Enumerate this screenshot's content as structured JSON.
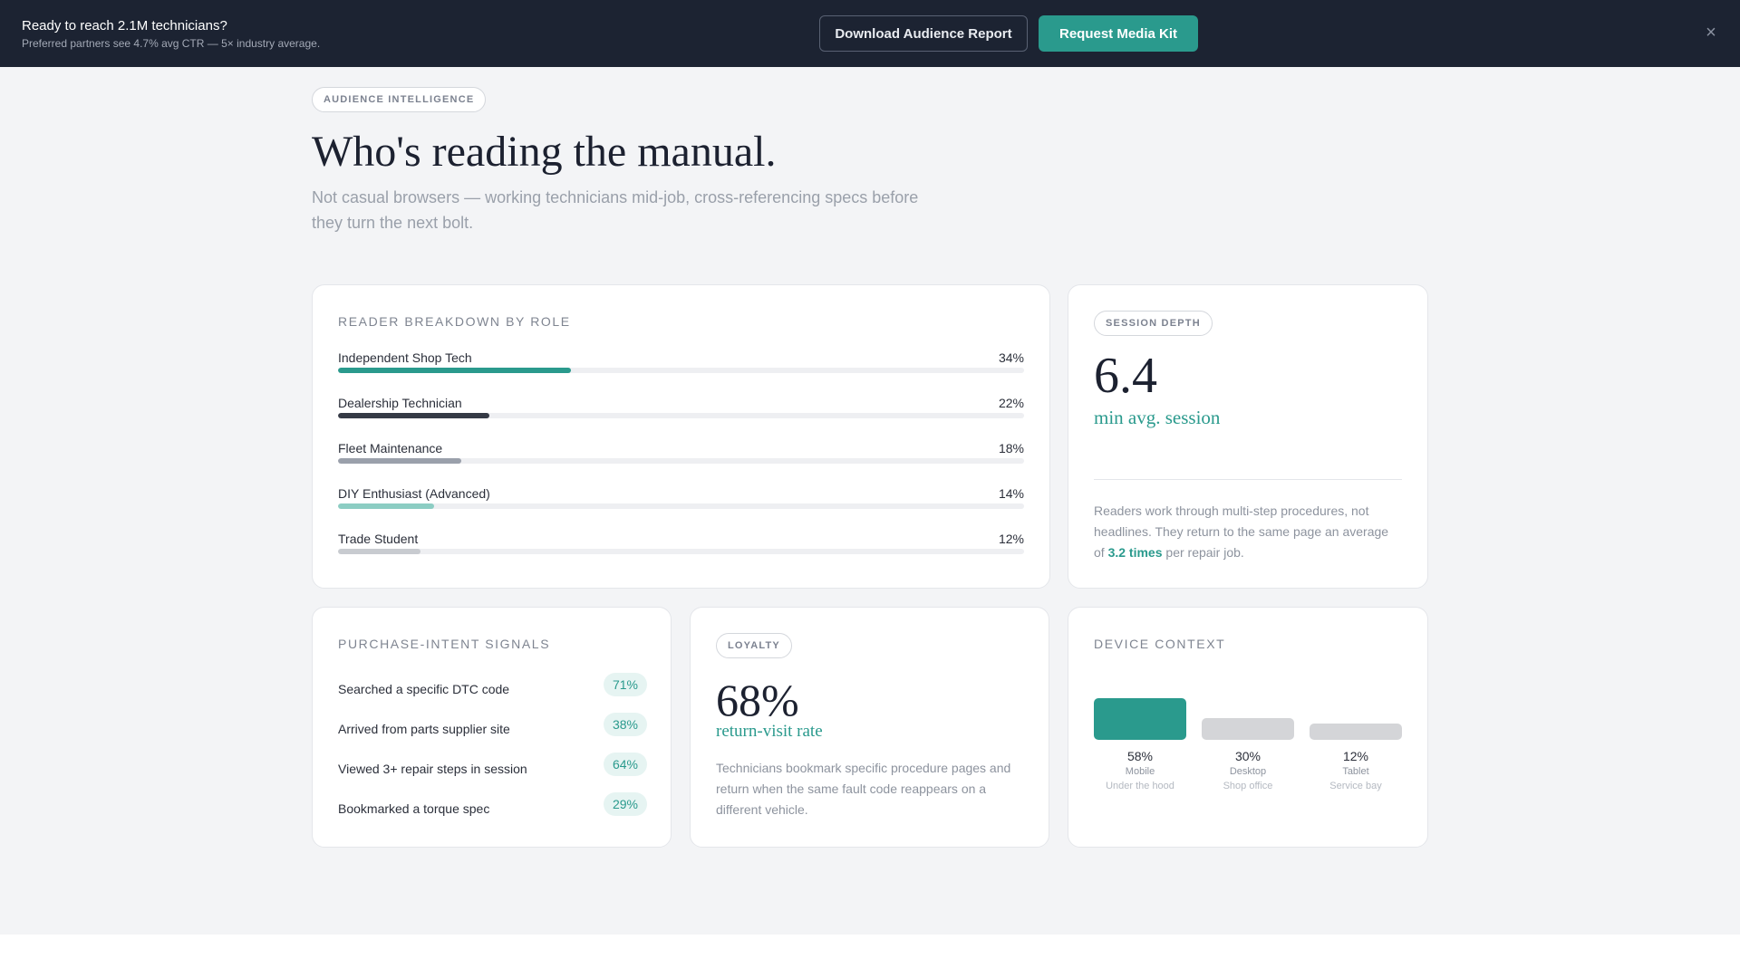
{
  "banner": {
    "title": "Ready to reach 2.1M technicians?",
    "subtitle": "Preferred partners see 4.7% avg CTR — 5× industry average.",
    "download_label": "Download Audience Report",
    "request_label": "Request Media Kit",
    "close_icon": "×"
  },
  "hero": {
    "eyebrow": "AUDIENCE INTELLIGENCE",
    "title": "Who's reading the manual.",
    "lede": "Not casual browsers — working technicians mid-job, cross-referencing specs before they turn the next bolt."
  },
  "roles": {
    "label": "READER BREAKDOWN BY ROLE",
    "items": [
      {
        "name": "Independent Shop Tech",
        "pct_label": "34%",
        "value": 34,
        "color": "#2a9a8d"
      },
      {
        "name": "Dealership Technician",
        "pct_label": "22%",
        "value": 22,
        "color": "#353a45"
      },
      {
        "name": "Fleet Maintenance",
        "pct_label": "18%",
        "value": 18,
        "color": "#9aa0ab"
      },
      {
        "name": "DIY Enthusiast (Advanced)",
        "pct_label": "14%",
        "value": 14,
        "color": "#8ccdc3"
      },
      {
        "name": "Trade Student",
        "pct_label": "12%",
        "value": 12,
        "color": "#c8cbd0"
      }
    ],
    "scale_max": 100
  },
  "session": {
    "pill": "SESSION DEPTH",
    "value": "6.4",
    "unit": "min avg. session",
    "desc_pre": "Readers work through multi-step procedures, not headlines. They return to the same page an average of ",
    "desc_hl": "3.2 times",
    "desc_post": " per repair job."
  },
  "intent": {
    "label": "PURCHASE-INTENT SIGNALS",
    "items": [
      {
        "text": "Searched a specific DTC code",
        "pct": "71%"
      },
      {
        "text": "Arrived from parts supplier site",
        "pct": "38%"
      },
      {
        "text": "Viewed 3+ repair steps in session",
        "pct": "64%"
      },
      {
        "text": "Bookmarked a torque spec",
        "pct": "29%"
      }
    ]
  },
  "loyalty": {
    "pill": "LOYALTY",
    "value": "68%",
    "unit": "return-visit rate",
    "desc": "Technicians bookmark specific procedure pages and return when the same fault code reappears on a different vehicle."
  },
  "device": {
    "label": "DEVICE CONTEXT",
    "items": [
      {
        "pct": "58%",
        "value": 58,
        "name": "Mobile",
        "context": "Under the hood",
        "color": "#2a9a8d"
      },
      {
        "pct": "30%",
        "value": 30,
        "name": "Desktop",
        "context": "Shop office",
        "color": "#d4d5d8"
      },
      {
        "pct": "12%",
        "value": 12,
        "name": "Tablet",
        "context": "Service bay",
        "color": "#d4d5d8"
      }
    ]
  }
}
